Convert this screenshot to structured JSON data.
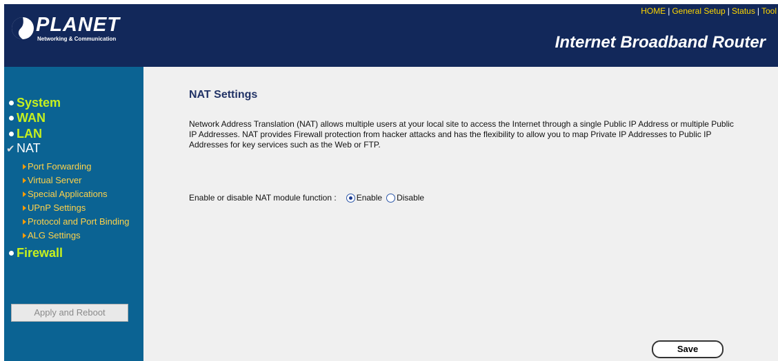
{
  "brand": {
    "name": "PLANET",
    "tagline": "Networking & Communication"
  },
  "top_nav": {
    "home": "HOME",
    "general_setup": "General Setup",
    "status": "Status",
    "tool": "Tool",
    "separator": "|"
  },
  "product_title": "Internet Broadband Router",
  "sidebar": {
    "items": [
      {
        "label": "System",
        "marker": "bullet"
      },
      {
        "label": "WAN",
        "marker": "bullet"
      },
      {
        "label": "LAN",
        "marker": "bullet"
      },
      {
        "label": "NAT",
        "marker": "check"
      },
      {
        "label": "Firewall",
        "marker": "bullet"
      }
    ],
    "nat_subitems": [
      "Port Forwarding",
      "Virtual Server",
      "Special Applications",
      "UPnP Settings",
      "Protocol and Port Binding",
      "ALG Settings"
    ],
    "apply_button": "Apply and Reboot"
  },
  "main": {
    "title": "NAT Settings",
    "description": "Network Address Translation (NAT) allows multiple users at your local site to access the Internet through a single Public IP Address or multiple Public IP Addresses. NAT provides Firewall protection from hacker attacks and has the flexibility to allow you to map Private IP Addresses to Public IP Addresses for key services such as the Web or FTP.",
    "nat_toggle": {
      "label": "Enable or disable NAT module function :",
      "options": [
        "Enable",
        "Disable"
      ],
      "selected": "Enable"
    },
    "save_button": "Save"
  },
  "colors": {
    "header_bg": "#12285a",
    "sidebar_bg": "#0b6393",
    "menu_text": "#c6f01e",
    "submenu_text": "#ffd24a",
    "top_nav_link": "#ffd700",
    "content_bg": "#f0f0f0"
  }
}
